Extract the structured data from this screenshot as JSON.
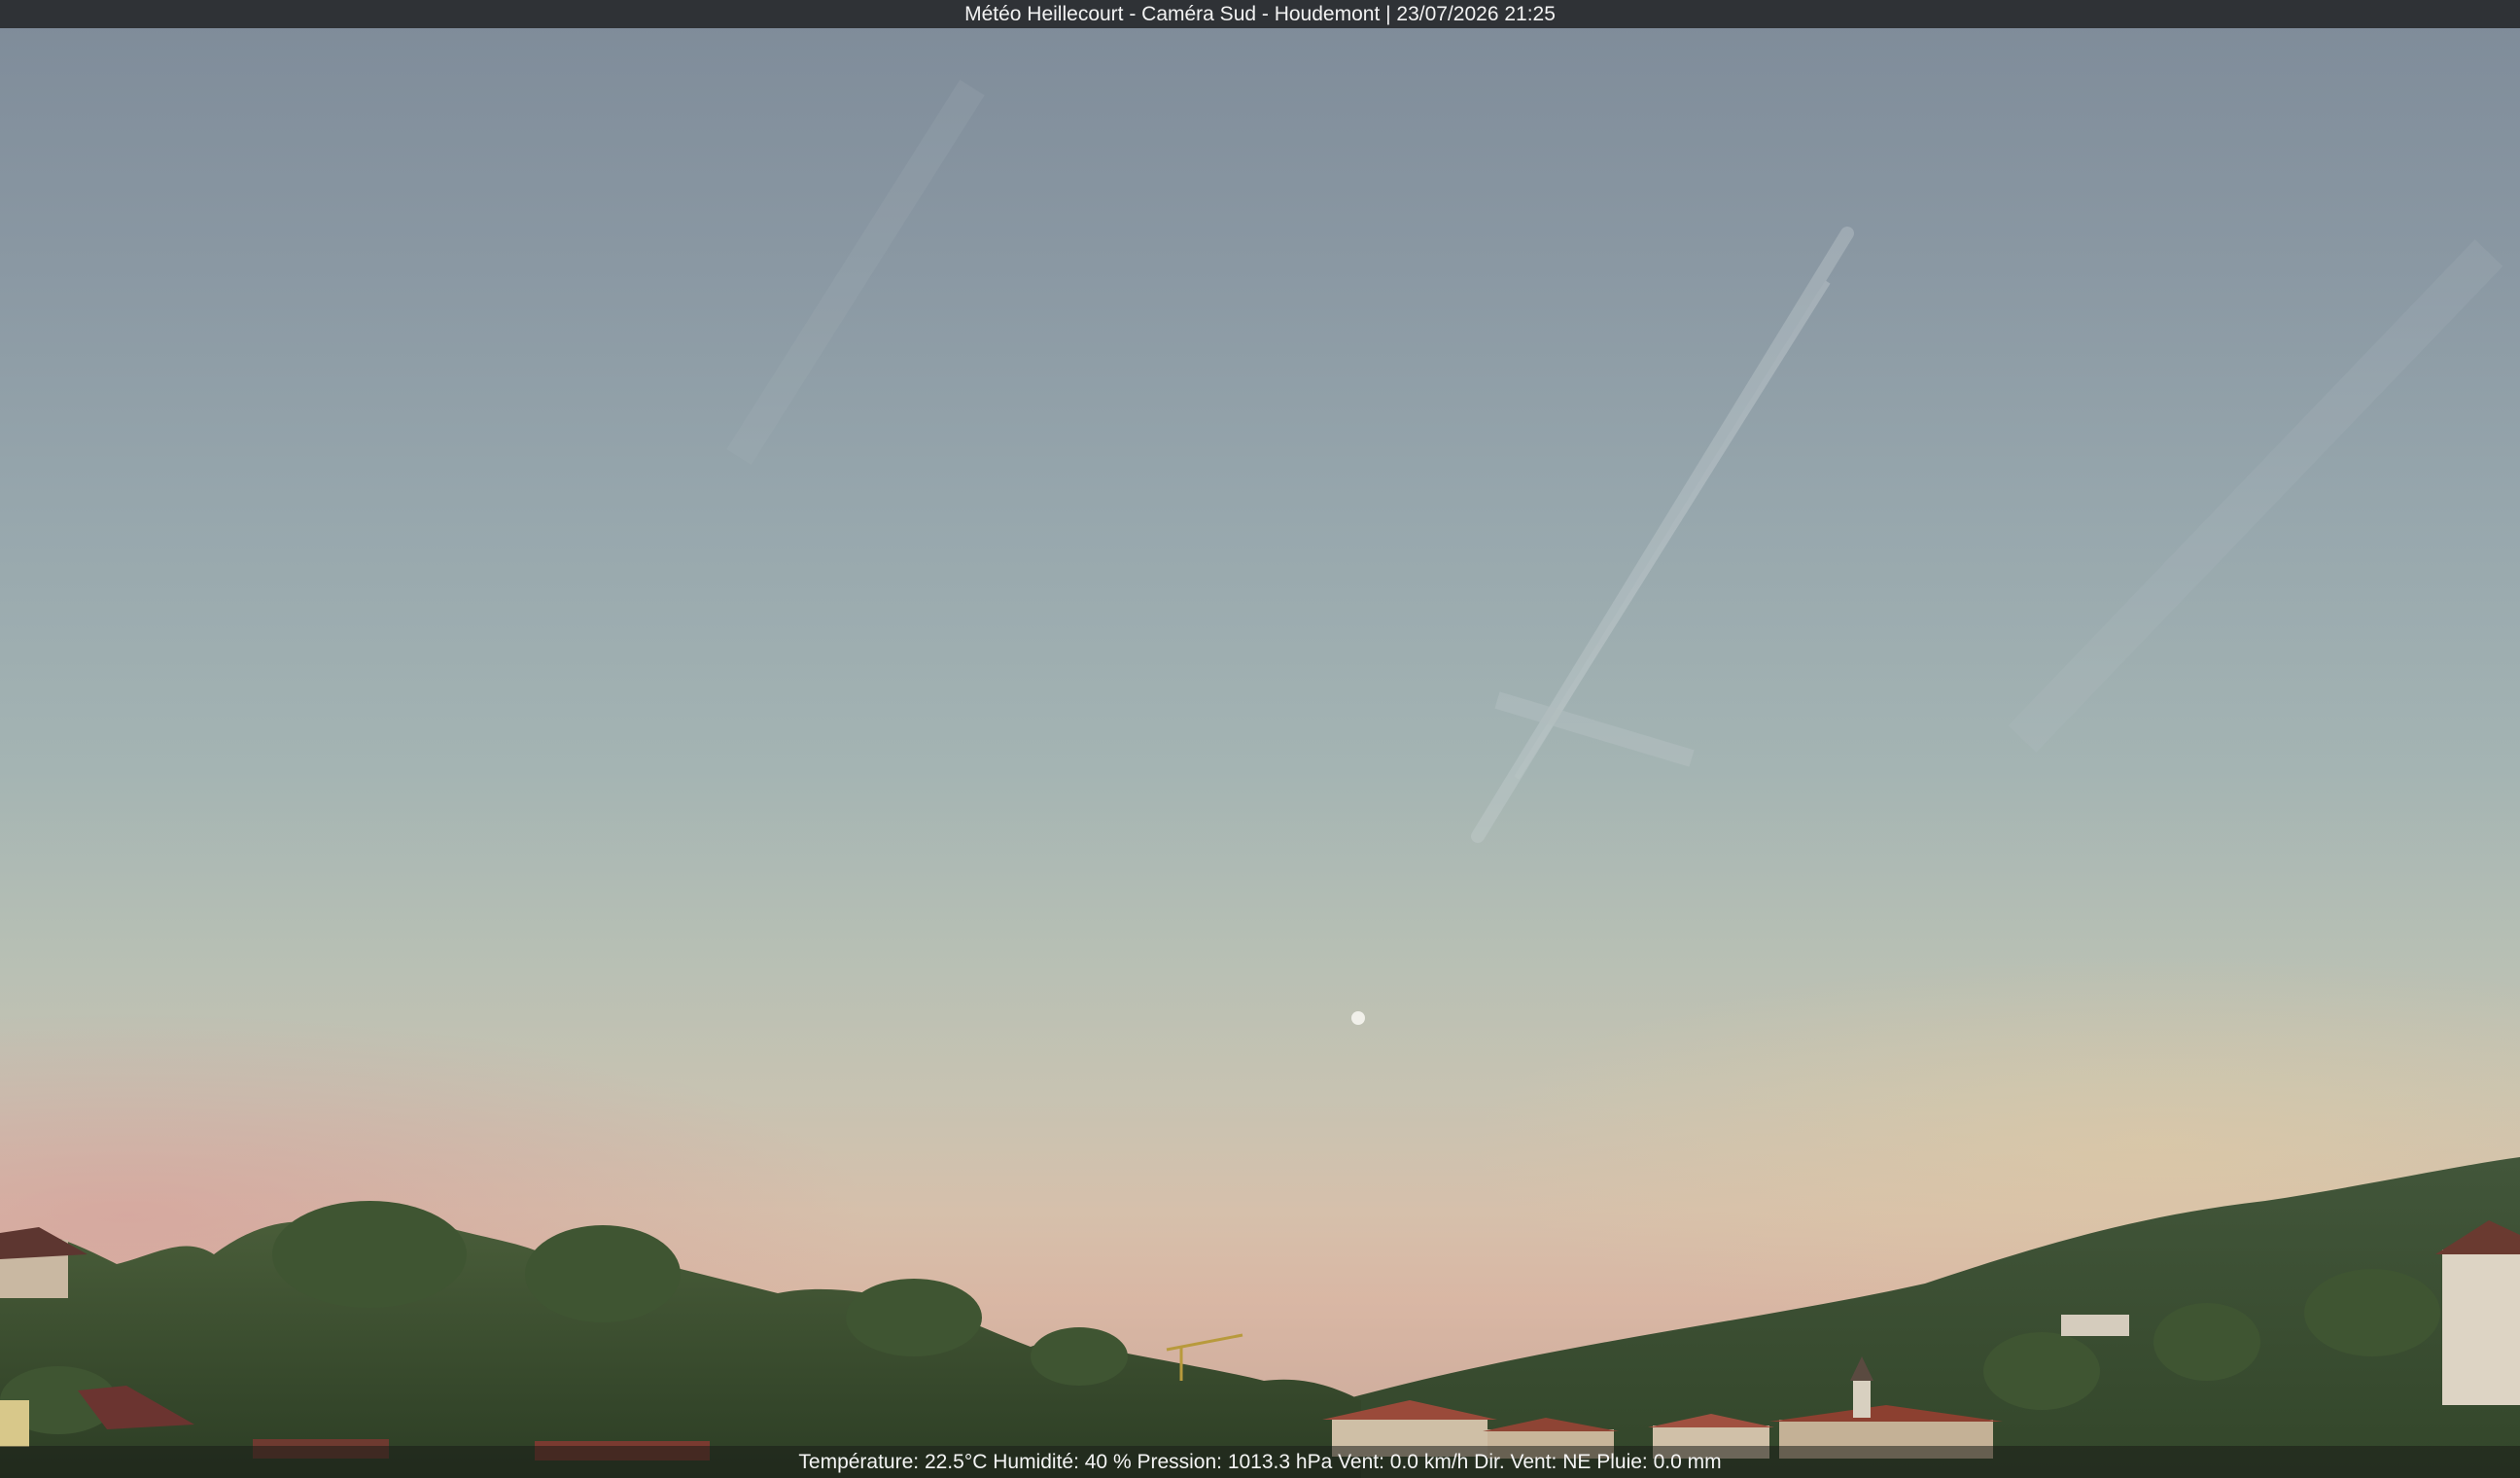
{
  "header": {
    "caption": "Météo Heillecourt - Caméra Sud - Houdemont | 23/07/2026 21:25"
  },
  "footer": {
    "weather_readout": "Température: 22.5°C  Humidité: 40 % Pression: 1013.3 hPa Vent: 0.0 km/h Dir. Vent: NE Pluie: 0.0 mm"
  },
  "colors": {
    "sky_top": "#7e8b99",
    "sky_horizon": "#d9b7a4",
    "trees": "#3d5230",
    "roofs": "#9a4a3a"
  }
}
